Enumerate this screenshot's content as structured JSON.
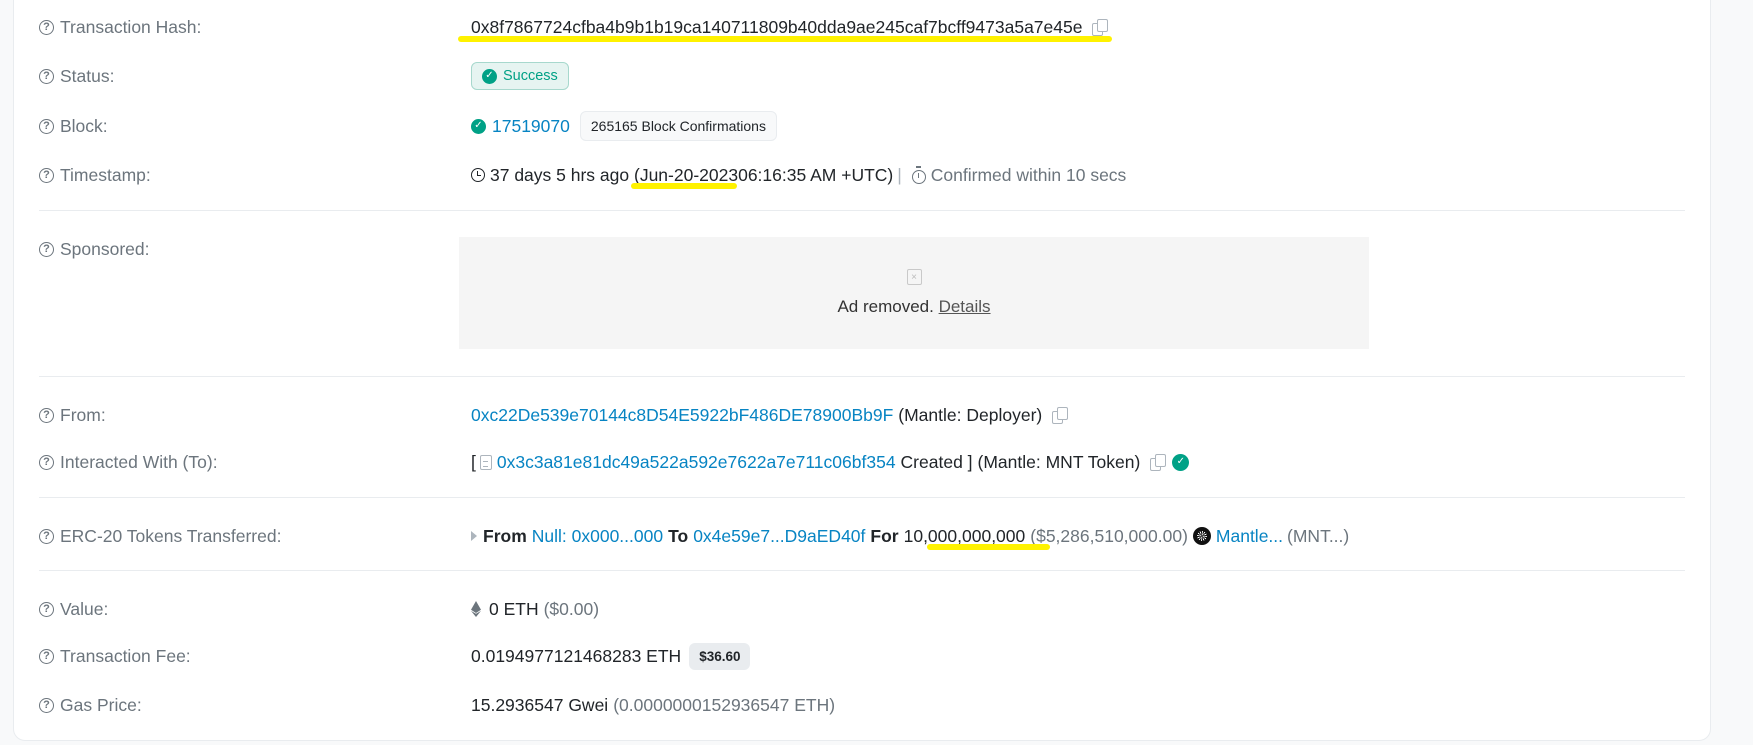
{
  "rows": {
    "tx_hash": {
      "label": "Transaction Hash:",
      "value": "0x8f7867724cfba4b9b1b19ca140711809b40dda9ae245caf7bcff9473a5a7e45e"
    },
    "status": {
      "label": "Status:",
      "value": "Success"
    },
    "block": {
      "label": "Block:",
      "number": "17519070",
      "confirmations": "265165 Block Confirmations"
    },
    "timestamp": {
      "label": "Timestamp:",
      "ago": "37 days 5 hrs ago (",
      "date": "Jun-20-2023",
      "time": " 06:16:35 AM +UTC)",
      "separator": "|",
      "confirmed": "Confirmed within 10 secs"
    },
    "sponsored": {
      "label": "Sponsored:",
      "ad_text": "Ad removed.",
      "ad_link": "Details"
    },
    "from": {
      "label": "From:",
      "address": "0xc22De539e70144c8D54E5922bF486DE78900Bb9F",
      "name": "(Mantle: Deployer)"
    },
    "interacted": {
      "label": "Interacted With (To):",
      "open_bracket": "[",
      "address": "0x3c3a81e81dc49a522a592e7622a7e711c06bf354",
      "created": "Created ]",
      "name": "(Mantle: MNT Token)"
    },
    "erc20": {
      "label": "ERC-20 Tokens Transferred:",
      "from_label": "From",
      "from_value": "Null: 0x000...000",
      "to_label": "To",
      "to_value": "0x4e59e7...D9aED40f",
      "for_label": "For",
      "amount": "10,000,000,000",
      "usd": "($5,286,510,000.00)",
      "token_name": "Mantle...",
      "token_symbol": "(MNT...)"
    },
    "value": {
      "label": "Value:",
      "eth": "0 ETH",
      "usd": "($0.00)"
    },
    "fee": {
      "label": "Transaction Fee:",
      "eth": "0.0194977121468283 ETH",
      "usd": "$36.60"
    },
    "gas": {
      "label": "Gas Price:",
      "gwei": "15.2936547 Gwei",
      "eth": "(0.0000000152936547 ETH)"
    }
  },
  "colors": {
    "link": "#0784c3",
    "success": "#00a186",
    "highlight": "#fff200",
    "muted": "#6c757d"
  }
}
